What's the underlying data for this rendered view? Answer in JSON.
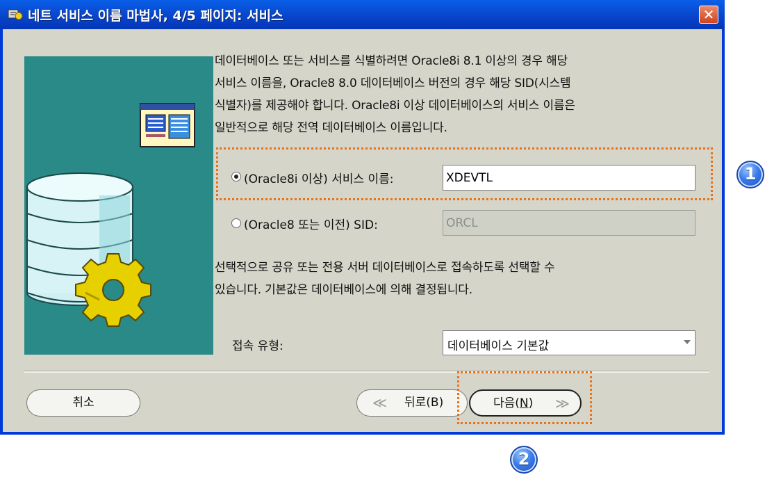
{
  "window": {
    "title": "네트 서비스 이름 마법사, 4/5 페이지: 서비스",
    "close_glyph": "✕"
  },
  "intro_lines": [
    "데이터베이스 또는 서비스를 식별하려면 Oracle8i 8.1 이상의 경우 해당",
    "서비스 이름을, Oracle8 8.0 데이터베이스 버전의 경우 해당 SID(시스템",
    "식별자)를 제공해야 합니다. Oracle8i 이상 데이터베이스의 서비스 이름은",
    "일반적으로 해당 전역 데이터베이스 이름입니다."
  ],
  "service_name": {
    "label": "(Oracle8i 이상) 서비스 이름:",
    "value": "XDEVTL",
    "selected": true
  },
  "sid": {
    "label": "(Oracle8 또는 이전) SID:",
    "value": "ORCL",
    "selected": false
  },
  "connection_lines": [
    "선택적으로 공유 또는 전용 서버 데이터베이스로 접속하도록 선택할 수",
    "있습니다. 기본값은 데이터베이스에 의해 결정됩니다."
  ],
  "connection_type": {
    "label": "접속 유형:",
    "selected": "데이터베이스 기본값"
  },
  "buttons": {
    "cancel": "취소",
    "back": "뒤로(B)",
    "next_prefix": "다음(",
    "next_key": "N",
    "next_suffix": ")",
    "back_glyph": "≪",
    "next_glyph": "≫"
  },
  "annotations": {
    "badge1": "1",
    "badge2": "2",
    "accent_color": "#e8711a"
  },
  "icons": {
    "title": "wizard-icon",
    "illustration": "database-gear-icon",
    "window": "document-icon"
  }
}
